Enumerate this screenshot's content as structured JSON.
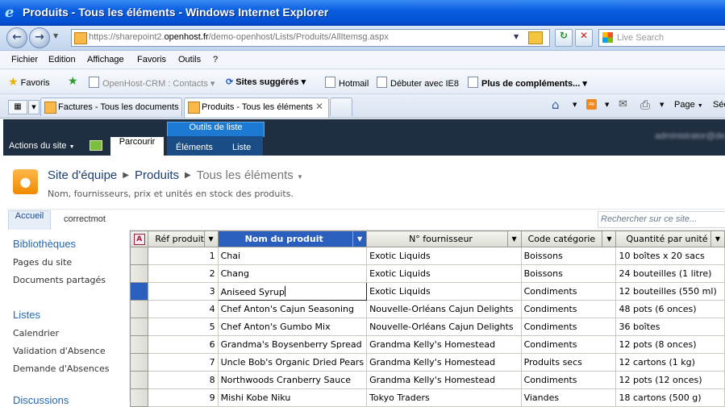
{
  "window": {
    "title": "Produits - Tous les éléments - Windows Internet Explorer"
  },
  "address": {
    "url_prefix": "https://sharepoint2.",
    "url_host": "openhost.fr",
    "url_suffix": "/demo-openhost/Lists/Produits/AllItemsg.aspx",
    "search_placeholder": "Live Search"
  },
  "menu": [
    "Fichier",
    "Edition",
    "Affichage",
    "Favoris",
    "Outils",
    "?"
  ],
  "favorites": {
    "label": "Favoris",
    "items": [
      "OpenHost-CRM : Contacts",
      "Sites suggérés",
      "Hotmail",
      "Débuter avec IE8",
      "Plus de compléments..."
    ]
  },
  "tabs": [
    {
      "label": "Factures - Tous les documents"
    },
    {
      "label": "Produits - Tous les éléments"
    }
  ],
  "commandbar": {
    "page": "Page",
    "securite": "Séc"
  },
  "ribbon": {
    "site_actions": "Actions du site",
    "browse": "Parcourir",
    "context_group": "Outils de liste",
    "tab_items": "Éléments",
    "tab_list": "Liste",
    "user": "administrator@de"
  },
  "header": {
    "site": "Site d'équipe",
    "list": "Produits",
    "view": "Tous les éléments",
    "description": "Nom, fournisseurs, prix et unités en stock des produits."
  },
  "toplinks": {
    "home": "Accueil",
    "other": "correctmot",
    "search_placeholder": "Rechercher sur ce site..."
  },
  "quicklaunch": {
    "libraries_heading": "Bibliothèques",
    "libraries": [
      "Pages du site",
      "Documents partagés"
    ],
    "lists_heading": "Listes",
    "lists": [
      "Calendrier",
      "Validation d'Absence",
      "Demande d'Absences"
    ],
    "discussions_heading": "Discussions"
  },
  "grid": {
    "columns": [
      "Réf produit",
      "Nom du produit",
      "N° fournisseur",
      "Code catégorie",
      "Quantité par unité"
    ],
    "rows": [
      [
        "1",
        "Chai",
        "Exotic Liquids",
        "Boissons",
        "10 boîtes x 20 sacs"
      ],
      [
        "2",
        "Chang",
        "Exotic Liquids",
        "Boissons",
        "24 bouteilles (1 litre)"
      ],
      [
        "3",
        "Aniseed Syrup",
        "Exotic Liquids",
        "Condiments",
        "12 bouteilles (550 ml)"
      ],
      [
        "4",
        "Chef Anton's Cajun Seasoning",
        "Nouvelle-Orléans Cajun Delights",
        "Condiments",
        "48 pots (6 onces)"
      ],
      [
        "5",
        "Chef Anton's Gumbo Mix",
        "Nouvelle-Orléans Cajun Delights",
        "Condiments",
        "36 boîtes"
      ],
      [
        "6",
        "Grandma's Boysenberry Spread",
        "Grandma Kelly's Homestead",
        "Condiments",
        "12 pots (8 onces)"
      ],
      [
        "7",
        "Uncle Bob's Organic Dried Pears",
        "Grandma Kelly's Homestead",
        "Produits secs",
        "12 cartons (1 kg)"
      ],
      [
        "8",
        "Northwoods Cranberry Sauce",
        "Grandma Kelly's Homestead",
        "Condiments",
        "12 pots (12 onces)"
      ],
      [
        "9",
        "Mishi Kobe Niku",
        "Tokyo Traders",
        "Viandes",
        "18 cartons (500 g)"
      ]
    ]
  }
}
